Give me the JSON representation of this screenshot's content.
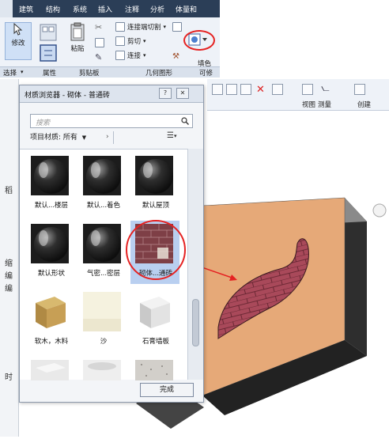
{
  "ribbon": {
    "tabs": [
      "建筑",
      "结构",
      "系统",
      "插入",
      "注释",
      "分析",
      "体量和"
    ],
    "modify_label": "修改",
    "paste_label": "粘贴",
    "tools": [
      "连接端切割",
      "剪切",
      "连接"
    ],
    "paint_label": "填色",
    "groups": [
      "选择",
      "属性",
      "剪贴板",
      "几何图形"
    ],
    "group_right_partial": "可修"
  },
  "right_toolbar": {
    "labels": [
      "视图",
      "测量",
      "创建"
    ]
  },
  "dialog": {
    "title": "材质浏览器 - 砌体 - 普通砖",
    "help_button": "?",
    "close_button": "✕",
    "search_placeholder": "搜索",
    "filter_label": "项目材质: 所有",
    "materials": [
      {
        "label": "默认...楼层",
        "type": "sphere-dark"
      },
      {
        "label": "默认...着色",
        "type": "sphere-dark"
      },
      {
        "label": "默认屋顶",
        "type": "sphere-dark"
      },
      {
        "label": "默认形状",
        "type": "sphere-dark"
      },
      {
        "label": "气密...密层",
        "type": "sphere-dark"
      },
      {
        "label": "砌体...通砖",
        "type": "brick",
        "selected": true
      },
      {
        "label": "软木，木料",
        "type": "wood-cube"
      },
      {
        "label": "沙",
        "type": "sand"
      },
      {
        "label": "石膏墙板",
        "type": "plaster-cube"
      },
      {
        "label": "",
        "type": "grey-cube"
      },
      {
        "label": "",
        "type": "grey-cylinder"
      },
      {
        "label": "",
        "type": "speckle"
      }
    ],
    "ok_label": "完成"
  },
  "colors": {
    "ribbon_bg": "#eef2f8",
    "tab_bar": "#2b3e57",
    "selection": "#b9cff0",
    "annotation_red": "#e52222",
    "wall_face": "#e4a574",
    "wall_dark": "#2a2a2a",
    "brick_fill": "#a9495a"
  }
}
